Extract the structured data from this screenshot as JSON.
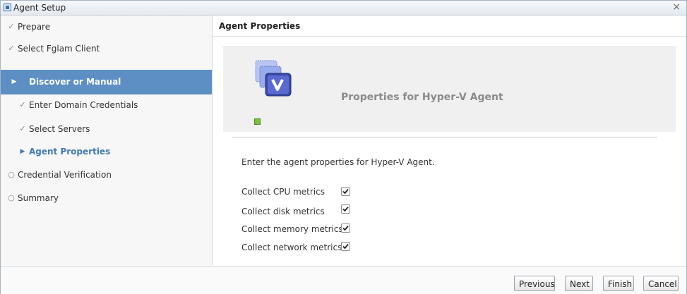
{
  "window": {
    "title": "Agent Setup",
    "close_glyph": "×"
  },
  "sidebar": {
    "items": [
      {
        "label": "Prepare",
        "state": "done",
        "mark": "✓"
      },
      {
        "label": "Select Fglam Client",
        "state": "done",
        "mark": "✓"
      },
      {
        "label": "Discover or Manual",
        "state": "active",
        "mark": "▶"
      },
      {
        "label": "Enter Domain Credentials",
        "state": "done",
        "mark": "✓"
      },
      {
        "label": "Select Servers",
        "state": "done",
        "mark": "✓"
      },
      {
        "label": "Agent Properties",
        "state": "current",
        "mark": "▶"
      },
      {
        "label": "Credential Verification",
        "state": "pending",
        "mark": "○"
      },
      {
        "label": "Summary",
        "state": "pending",
        "mark": "○"
      }
    ]
  },
  "main": {
    "header": "Agent Properties",
    "panel_title": "Properties for Hyper-V Agent",
    "agent_icon": "hyper-v-agent-icon",
    "status_icon": "status-ok-icon",
    "intro": "Enter the agent properties for Hyper-V Agent.",
    "options": [
      {
        "label": "Collect CPU metrics",
        "checked": true
      },
      {
        "label": "Collect disk metrics",
        "checked": true
      },
      {
        "label": "Collect memory metrics",
        "checked": true
      },
      {
        "label": "Collect network metrics",
        "checked": true
      }
    ]
  },
  "footer": {
    "previous_label": "Previous",
    "next_label": "Next",
    "finish_label": "Finish",
    "cancel_label": "Cancel"
  },
  "colors": {
    "active_nav": "#5d8fc4",
    "current_nav_text": "#3f79b5",
    "status_ok": "#7bbf3d"
  }
}
